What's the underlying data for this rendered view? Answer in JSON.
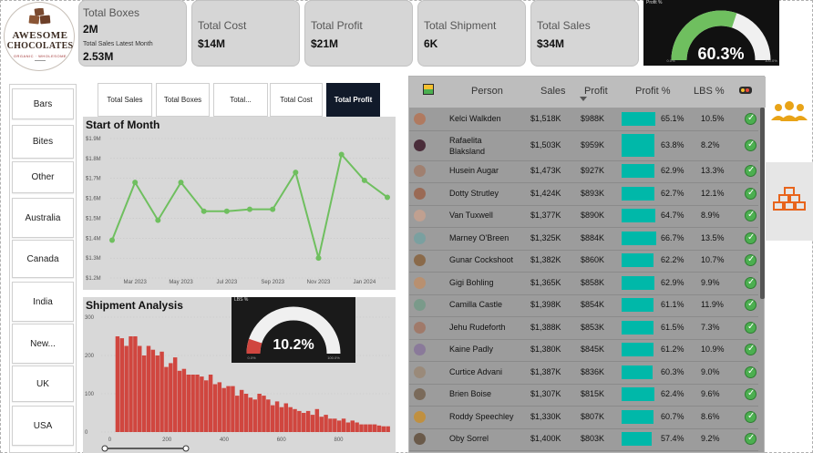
{
  "logo": {
    "line1": "AWESOME",
    "line2": "CHOCOLATES",
    "tagline": "ORGANIC · WHOLESOME"
  },
  "kpi": {
    "total_boxes": {
      "title": "Total Boxes",
      "value": "2M",
      "sub_title": "Total Sales Latest Month",
      "sub_value": "2.53M"
    },
    "total_cost": {
      "title": "Total Cost",
      "value": "$14M"
    },
    "total_profit": {
      "title": "Total Profit",
      "value": "$21M"
    },
    "total_shipment": {
      "title": "Total Shipment",
      "value": "6K"
    },
    "total_sales": {
      "title": "Total Sales",
      "value": "$34M"
    }
  },
  "profit_gauge": {
    "label": "Profit %",
    "value": 60.3,
    "display": "60.3%",
    "min_label": "0.0%",
    "max_label": "100.0%",
    "color": "#6fbf5f"
  },
  "slicer": {
    "items": [
      "Bars",
      "Bites",
      "Other",
      "Australia",
      "Canada",
      "India",
      "New...",
      "UK",
      "USA"
    ]
  },
  "tabs": [
    {
      "label": "Total Sales",
      "active": false
    },
    {
      "label": "Total Boxes",
      "active": false
    },
    {
      "label": "Total...",
      "active": false
    },
    {
      "label": "Total Cost",
      "active": false
    },
    {
      "label": "Total Profit",
      "active": true
    }
  ],
  "line_chart_title": "Start of Month",
  "shipment_title": "Shipment Analysis",
  "chart_data": [
    {
      "type": "line",
      "title": "Start of Month",
      "y_ticks": [
        "$1.2M",
        "$1.3M",
        "$1.4M",
        "$1.5M",
        "$1.6M",
        "$1.7M",
        "$1.8M",
        "$1.9M"
      ],
      "x_ticks": [
        "Mar 2023",
        "May 2023",
        "Jul 2023",
        "Sep 2023",
        "Nov 2023",
        "Jan 2024"
      ],
      "ylim": [
        1.2,
        1.9
      ],
      "x": [
        "2023-02",
        "2023-03",
        "2023-04",
        "2023-05",
        "2023-06",
        "2023-07",
        "2023-08",
        "2023-09",
        "2023-10",
        "2023-11",
        "2023-12",
        "2024-01",
        "2024-02"
      ],
      "values": [
        1.39,
        1.68,
        1.49,
        1.68,
        1.535,
        1.535,
        1.545,
        1.545,
        1.73,
        1.3,
        1.82,
        1.69,
        1.605
      ],
      "color": "#6fbf5f",
      "grid": true
    },
    {
      "type": "bar",
      "title": "Shipment Analysis",
      "y_ticks": [
        "0",
        "100",
        "200",
        "300"
      ],
      "x_ticks": [
        "0",
        "200",
        "400",
        "600",
        "800"
      ],
      "ylim": [
        0,
        300
      ],
      "xlim": [
        -30,
        980
      ],
      "bin_width": 18,
      "values": [
        250,
        245,
        225,
        250,
        250,
        225,
        200,
        225,
        215,
        200,
        210,
        170,
        180,
        195,
        160,
        165,
        150,
        150,
        150,
        145,
        135,
        150,
        125,
        130,
        115,
        120,
        120,
        95,
        110,
        100,
        90,
        85,
        100,
        95,
        85,
        70,
        80,
        65,
        75,
        65,
        60,
        55,
        50,
        55,
        45,
        60,
        40,
        45,
        35,
        35,
        30,
        35,
        25,
        30,
        25,
        20,
        20,
        20,
        20,
        17,
        15,
        15
      ],
      "color": "#d0463f"
    }
  ],
  "lbs_gauge": {
    "label": "LBS %",
    "value": 10.2,
    "display": "10.2%",
    "min_label": "0.0%",
    "max_label": "100.0%",
    "color": "#d0463f"
  },
  "table": {
    "headers": {
      "person": "Person",
      "sales": "Sales",
      "profit": "Profit",
      "profit_pct": "Profit %",
      "lbs_pct": "LBS %"
    },
    "rows": [
      {
        "person": "Kelci Walkden",
        "sales": "$1,518K",
        "profit": "$988K",
        "profit_pct": "65.1%",
        "pct": 65.1,
        "lbs": "10.5%"
      },
      {
        "person": "Rafaelita Blaksland",
        "sales": "$1,503K",
        "profit": "$959K",
        "profit_pct": "63.8%",
        "pct": 63.8,
        "lbs": "8.2%"
      },
      {
        "person": "Husein Augar",
        "sales": "$1,473K",
        "profit": "$927K",
        "profit_pct": "62.9%",
        "pct": 62.9,
        "lbs": "13.3%"
      },
      {
        "person": "Dotty Strutley",
        "sales": "$1,424K",
        "profit": "$893K",
        "profit_pct": "62.7%",
        "pct": 62.7,
        "lbs": "12.1%"
      },
      {
        "person": "Van Tuxwell",
        "sales": "$1,377K",
        "profit": "$890K",
        "profit_pct": "64.7%",
        "pct": 64.7,
        "lbs": "8.9%"
      },
      {
        "person": "Marney O'Breen",
        "sales": "$1,325K",
        "profit": "$884K",
        "profit_pct": "66.7%",
        "pct": 66.7,
        "lbs": "13.5%"
      },
      {
        "person": "Gunar Cockshoot",
        "sales": "$1,382K",
        "profit": "$860K",
        "profit_pct": "62.2%",
        "pct": 62.2,
        "lbs": "10.7%"
      },
      {
        "person": "Gigi Bohling",
        "sales": "$1,365K",
        "profit": "$858K",
        "profit_pct": "62.9%",
        "pct": 62.9,
        "lbs": "9.9%"
      },
      {
        "person": "Camilla Castle",
        "sales": "$1,398K",
        "profit": "$854K",
        "profit_pct": "61.1%",
        "pct": 61.1,
        "lbs": "11.9%"
      },
      {
        "person": "Jehu Rudeforth",
        "sales": "$1,388K",
        "profit": "$853K",
        "profit_pct": "61.5%",
        "pct": 61.5,
        "lbs": "7.3%"
      },
      {
        "person": "Kaine Padly",
        "sales": "$1,380K",
        "profit": "$845K",
        "profit_pct": "61.2%",
        "pct": 61.2,
        "lbs": "10.9%"
      },
      {
        "person": "Curtice Advani",
        "sales": "$1,387K",
        "profit": "$836K",
        "profit_pct": "60.3%",
        "pct": 60.3,
        "lbs": "9.0%"
      },
      {
        "person": "Brien Boise",
        "sales": "$1,307K",
        "profit": "$815K",
        "profit_pct": "62.4%",
        "pct": 62.4,
        "lbs": "9.6%"
      },
      {
        "person": "Roddy Speechley",
        "sales": "$1,330K",
        "profit": "$807K",
        "profit_pct": "60.7%",
        "pct": 60.7,
        "lbs": "8.6%"
      },
      {
        "person": "Oby Sorrel",
        "sales": "$1,400K",
        "profit": "$803K",
        "profit_pct": "57.4%",
        "pct": 57.4,
        "lbs": "9.2%"
      }
    ]
  },
  "colors": {
    "teal_bar": "#00b8a9",
    "check_green": "#4caf50",
    "people_icon": "#e8a317",
    "boxes_icon": "#e8641c"
  },
  "icons": [
    "people-icon",
    "boxes-icon",
    "check-circle-icon",
    "sort-desc-icon"
  ]
}
